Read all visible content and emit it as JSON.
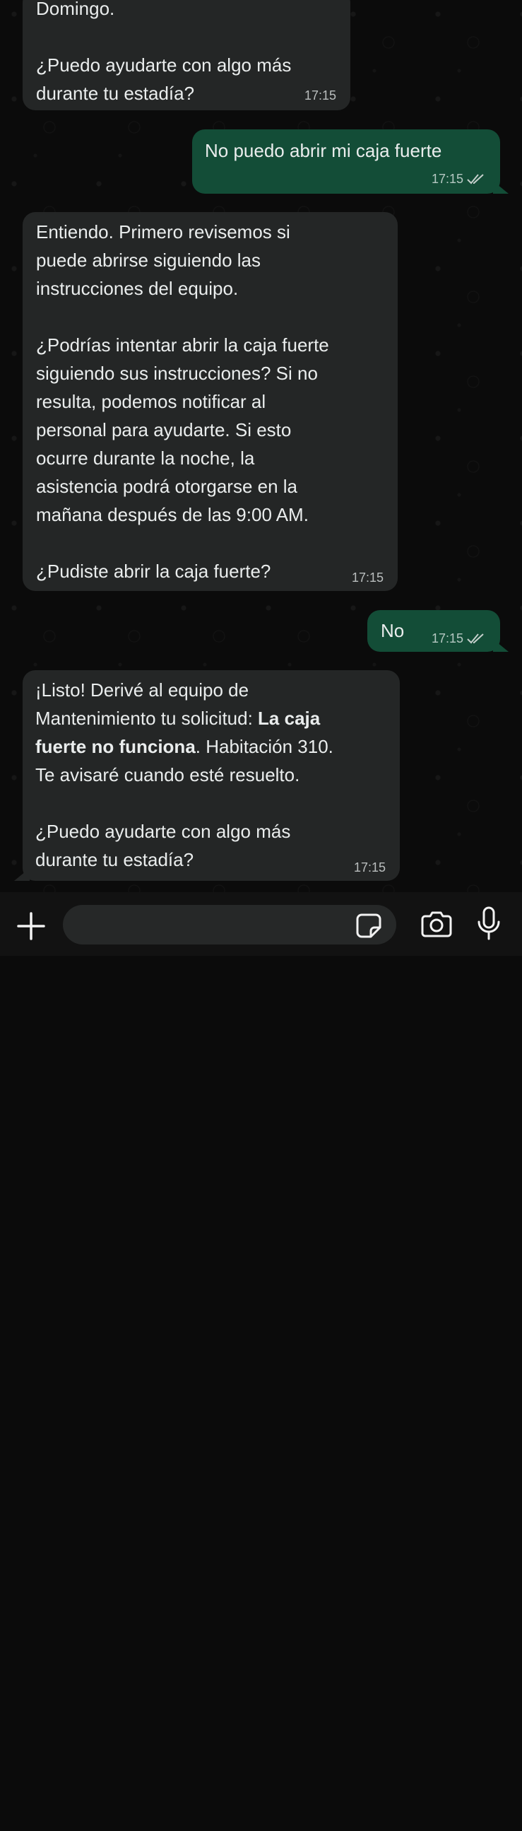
{
  "messages": [
    {
      "id": "m1",
      "direction": "incoming",
      "text_top": "Domingo.",
      "text": "¿Puedo ayudarte con algo más\ndurante tu estadía?",
      "time": "17:15"
    },
    {
      "id": "m2",
      "direction": "outgoing",
      "text": "No puedo abrir mi caja fuerte",
      "time": "17:15",
      "status": "read"
    },
    {
      "id": "m3",
      "direction": "incoming",
      "p1": "Entiendo. Primero revisemos si\npuede abrirse siguiendo las\ninstrucciones del equipo.",
      "p2": "¿Podrías intentar abrir la caja fuerte\nsiguiendo sus instrucciones? Si no\nresulta, podemos notificar al\npersonal para ayudarte. Si esto\nocurre durante la noche, la\nasistencia podrá otorgarse en la\nmañana después de las 9:00 AM.",
      "p3": "¿Pudiste abrir la caja fuerte?",
      "time": "17:15"
    },
    {
      "id": "m4",
      "direction": "outgoing",
      "text": "No",
      "time": "17:15",
      "status": "read"
    },
    {
      "id": "m5",
      "direction": "incoming",
      "line1": "¡Listo! Derivé al equipo de",
      "line2_pre": "Mantenimiento tu solicitud: ",
      "line2_bold": "La caja",
      "line3_bold": "fuerte no funciona",
      "line3_post": ". Habitación 310.",
      "line4": "Te avisaré cuando esté resuelto.",
      "p2": "¿Puedo ayudarte con algo más\ndurante tu estadía?",
      "time": "17:15"
    }
  ],
  "composer": {
    "input_value": "",
    "icons": [
      "plus-icon",
      "sticker-icon",
      "camera-icon",
      "microphone-icon"
    ]
  },
  "colors": {
    "incoming_bubble": "#242626",
    "outgoing_bubble": "#134d37",
    "background": "#0b0b0b",
    "read_ticks": "#c6d0cc"
  }
}
